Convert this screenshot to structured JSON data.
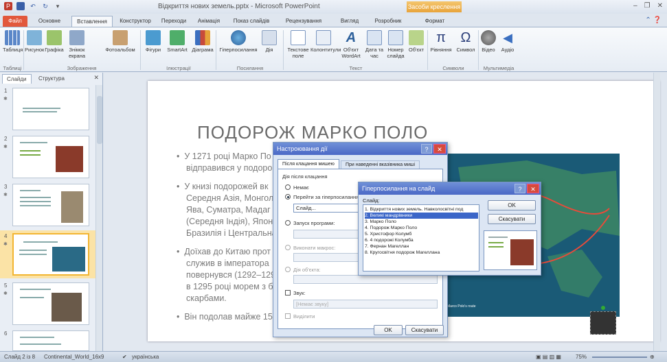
{
  "window": {
    "title": "Відкриття нових земель.pptx - Microsoft PowerPoint",
    "context_tab_title": "Засоби креслення"
  },
  "tabs": [
    "Файл",
    "Основне",
    "Вставлення",
    "Конструктор",
    "Переходи",
    "Анімація",
    "Показ слайдів",
    "Рецензування",
    "Вигляд",
    "Розробник",
    "Формат"
  ],
  "ribbon": {
    "buttons": [
      "Таблиця",
      "Рисунок",
      "Графіка",
      "Знімок екрана",
      "Фотоальбом",
      "Фігури",
      "SmartArt",
      "Діаграма",
      "Гіперпосилання",
      "Дія",
      "Текстове поле",
      "Колонтитули",
      "Об'єкт WordArt",
      "Дата та час",
      "Номер слайда",
      "Об'єкт",
      "Рівняння",
      "Символ",
      "Відео",
      "Аудіо"
    ],
    "groups": [
      "Таблиці",
      "Зображення",
      "Ілюстрації",
      "Посилання",
      "Текст",
      "Символи",
      "Мультимедіа"
    ]
  },
  "left_panel": {
    "tab_slides": "Слайди",
    "tab_outline": "Структура",
    "thumbs": [
      "1",
      "2",
      "3",
      "4",
      "5",
      "6"
    ]
  },
  "slide": {
    "title": "ПОДОРОЖ МАРКО ПОЛО",
    "bullets": [
      "У 1271 році Марко По",
      "відправився у подоро",
      "У книзі подорожей вк",
      "Середня Азія, Монгол",
      "Ява, Суматра, Мадаг",
      "(Середня Індія), Японія",
      "Бразилія і Центральна",
      "Доїхав до Китаю прот",
      "служив в імператора",
      "повернувся (1292–1295",
      "в 1295 році морем з б",
      "скарбами.",
      "Він подолав майже 15"
    ],
    "map_caption": "Marco Polo's route"
  },
  "dialog_action": {
    "title": "Настроювання дії",
    "tab_click": "Після клацання мишею",
    "tab_hover": "При наведенні вказівника миші",
    "section": "Дія після клацання",
    "opt_none": "Немає",
    "opt_hyperlink": "Перейти за гіперпосиланням:",
    "hyperlink_value": "Слайд...",
    "opt_run": "Запуск програми:",
    "opt_macro": "Виконати макрос:",
    "opt_object": "Дія об'єкта:",
    "sound": "Звук:",
    "sound_value": "[Немає звуку]",
    "highlight": "Виділити",
    "ok": "OK",
    "cancel": "Скасувати"
  },
  "dialog_link": {
    "title": "Гіперпосилання на слайд",
    "label": "Слайд:",
    "items": [
      "1. Відкриття нових земель. Навколосвітні под",
      "2. Великі мандрівники",
      "3. Марко Поло",
      "4. Подорож Марко Поло",
      "5. Христофор Колумб",
      "6. 4 подорожі Колумба",
      "7. Фернан Магеллан",
      "8. Кругосвітня подорож Магеллана"
    ],
    "selected_index": 1,
    "ok": "OK",
    "cancel": "Скасувати"
  },
  "status": {
    "slide": "Слайд 2 із 8",
    "theme": "Continental_World_16x9",
    "lang": "українська",
    "zoom": "75%"
  }
}
